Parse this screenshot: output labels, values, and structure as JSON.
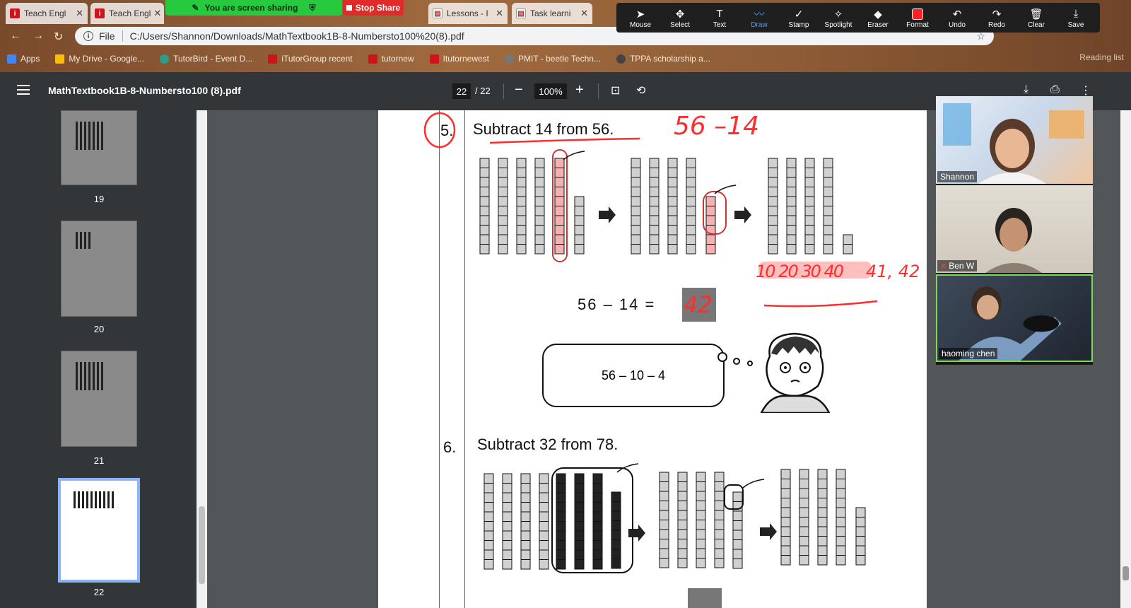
{
  "browser": {
    "tabs": [
      {
        "label": "Teach Engl",
        "favicon": "itutor-icon"
      },
      {
        "label": "Teach Engl",
        "favicon": "itutor-icon"
      },
      {
        "label": "Lessons - I",
        "favicon": "doc-icon"
      },
      {
        "label": "Task learni",
        "favicon": "doc-icon"
      }
    ],
    "share_status": "You are screen sharing",
    "stop_share_label": "Stop Share",
    "url_prefix": "File",
    "url": "C:/Users/Shannon/Downloads/MathTextbook1B-8-Numbersto100%20(8).pdf",
    "bookmarks": [
      {
        "label": "Apps",
        "color": "#4285f4"
      },
      {
        "label": "My Drive - Google...",
        "color": "#fbbc04"
      },
      {
        "label": "TutorBird - Event D...",
        "color": "#2a9d8f"
      },
      {
        "label": "iTutorGroup recent",
        "color": "#d0121b"
      },
      {
        "label": "tutornew",
        "color": "#d0121b"
      },
      {
        "label": "Itutornewest",
        "color": "#d0121b"
      },
      {
        "label": "PMIT - beetle Techn...",
        "color": "#777777"
      },
      {
        "label": "TPPA scholarship a...",
        "color": "#444444"
      }
    ],
    "reading_list": "Reading list"
  },
  "annotation_toolbar": {
    "tools": [
      {
        "label": "Mouse",
        "icon": "cursor-icon",
        "glyph": "➤"
      },
      {
        "label": "Select",
        "icon": "select-icon",
        "glyph": "✥"
      },
      {
        "label": "Text",
        "icon": "text-icon",
        "glyph": "T"
      },
      {
        "label": "Draw",
        "icon": "draw-icon",
        "glyph": "〰",
        "active": true
      },
      {
        "label": "Stamp",
        "icon": "stamp-icon",
        "glyph": "✓"
      },
      {
        "label": "Spotlight",
        "icon": "spotlight-icon",
        "glyph": "✧"
      },
      {
        "label": "Eraser",
        "icon": "eraser-icon",
        "glyph": "◆"
      },
      {
        "label": "Format",
        "icon": "format-icon",
        "glyph": ""
      },
      {
        "label": "Undo",
        "icon": "undo-icon",
        "glyph": "↶"
      },
      {
        "label": "Redo",
        "icon": "redo-icon",
        "glyph": "↷"
      },
      {
        "label": "Clear",
        "icon": "trash-icon",
        "glyph": "🗑"
      },
      {
        "label": "Save",
        "icon": "save-icon",
        "glyph": "⤓"
      }
    ],
    "format_color": "#ff2020"
  },
  "pdf": {
    "title": "MathTextbook1B-8-Numbersto100 (8).pdf",
    "current_page": "22",
    "total_pages": "/ 22",
    "zoom": "100%",
    "thumbnails": [
      {
        "page": "19"
      },
      {
        "page": "20"
      },
      {
        "page": "21"
      },
      {
        "page": "22",
        "selected": true
      }
    ]
  },
  "page_content": {
    "q5_num": "5.",
    "q5_text": "Subtract 14 from 56.",
    "q5_equation": "56 – 14 =",
    "bubble_text": "56 – 10 – 4",
    "q6_num": "6.",
    "q6_text": "Subtract 32 from 78.",
    "ink_title": "56 –14",
    "ink_answer": "42",
    "ink_count": "10 20 30 40",
    "ink_count2": "41, 42",
    "ink_color": "#ff2d2d"
  },
  "video": {
    "participants": [
      {
        "name": "Shannon",
        "muted": false
      },
      {
        "name": "Ben W",
        "muted": true
      },
      {
        "name": "haoming   chen",
        "muted": false,
        "active_speaker": true
      }
    ]
  }
}
